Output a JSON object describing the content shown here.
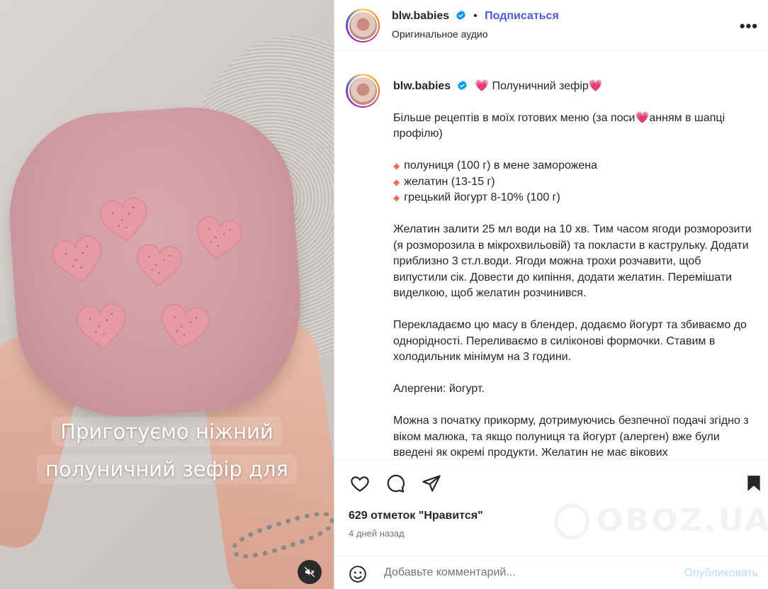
{
  "media": {
    "caption_line1": "Приготуємо ніжний",
    "caption_line2": "полуничний зефір для",
    "mute_icon": "speaker-muted-icon"
  },
  "header": {
    "username": "blw.babies",
    "separator": "•",
    "follow_label": "Подписаться",
    "audio_label": "Оригинальное аудио",
    "more_label": "•••"
  },
  "post": {
    "username": "blw.babies",
    "title": "💗 Полуничний зефір💗",
    "intro": "Більше рецептів в моїх готових меню (за поси💗анням в шапці профілю)",
    "ingredients": [
      "полуниця (100 г) в мене заморожена",
      "желатин (13-15 г)",
      "грецький йогурт 8-10% (100 г)"
    ],
    "bullet_symbol": "🔸",
    "paragraph1": "Желатин залити 25 мл води на 10 хв. Тим часом ягоди розморозити (я розморозила в мікрохвильовій) та покласти в каструльку. Додати приблизно 3 ст.л.води. Ягоди можна трохи розчавити, щоб випустили сік. Довести до кипіння, додати желатин. Перемішати виделкою, щоб желатин розчинився.",
    "paragraph2": "Перекладаємо цю масу в блендер, додаємо йогурт та збиваємо до однорідності. Переливаємо в силіконові формочки. Ставим в холодильник мінімум на 3 години.",
    "paragraph3": "Алергени: йогурт.",
    "paragraph4": "Можна з початку прикорму, дотримуючись безпечної подачі згідно з віком малюка, та якщо полуниця та йогурт (алерген) вже були введені як окремі продукти. Желатин не має вікових"
  },
  "actions": {
    "likes_text": "629 отметок \"Нравится\"",
    "time_text": "4 дней назад",
    "comment_placeholder": "Добавьте комментарий...",
    "publish_label": "Опубликовать"
  },
  "watermark": {
    "text": "OBOZ.UA"
  },
  "colors": {
    "follow": "#4f5bd5",
    "publish_disabled": "#b2dffc",
    "verified": "#0095f6"
  }
}
